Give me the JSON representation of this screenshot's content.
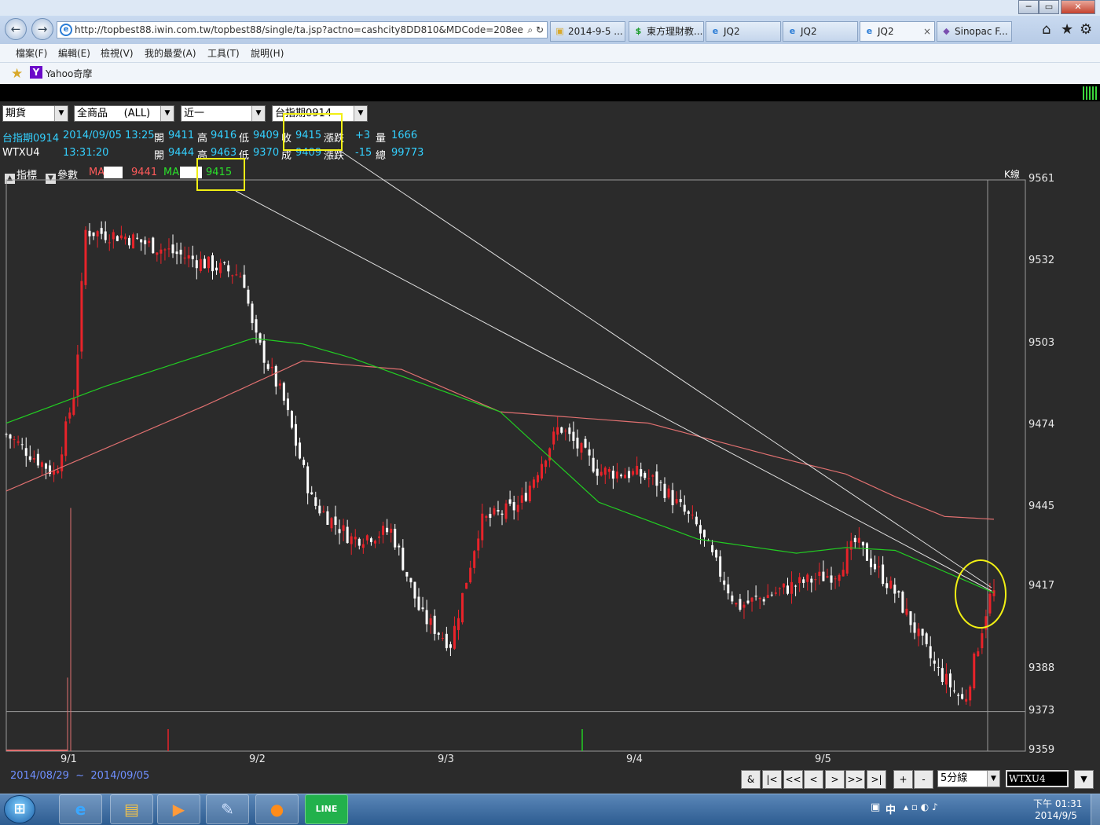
{
  "browser": {
    "nav_back": "←",
    "nav_forward": "→",
    "url": "http://topbest88.iwin.com.tw/topbest88/single/ta.jsp?actno=cashcity8DD810&MDCode=208ee",
    "url_icons": "⌕ ↻",
    "tabs": [
      {
        "label": "2014-9-5 ...",
        "icon": "folder-icon"
      },
      {
        "label": "東方理財教...",
        "icon": "dollar-icon"
      },
      {
        "label": "JQ2",
        "icon": "ie-icon"
      },
      {
        "label": "JQ2",
        "icon": "ie-icon"
      },
      {
        "label": "JQ2",
        "icon": "ie-icon",
        "close": "×"
      },
      {
        "label": "Sinopac F...",
        "icon": "sinopac-icon"
      }
    ],
    "tool_icons": {
      "home": "⌂",
      "favorites": "★",
      "settings": "⚙"
    },
    "window_buttons": {
      "min": "─",
      "max": "▭",
      "close": "✕"
    },
    "menu": [
      "檔案(F)",
      "編輯(E)",
      "檢視(V)",
      "我的最愛(A)",
      "工具(T)",
      "說明(H)"
    ],
    "favorites": {
      "yahoo_icon": "Y",
      "yahoo_label": "Yahoo奇摩"
    }
  },
  "app": {
    "selects": {
      "market": "期貨",
      "product": "全商品     (ALL)",
      "contract_month": "近一",
      "symbol": "台指期0914"
    },
    "quote1": {
      "name": "台指期0914",
      "datetime": "2014/09/05 13:25",
      "open_label": "開",
      "open": "9411",
      "high_label": "高",
      "high": "9416",
      "low_label": "低",
      "low": "9409",
      "close_label": "收",
      "close": "9415",
      "change_label": "漲跌",
      "change": "+3",
      "volume_label": "量",
      "volume": "1666"
    },
    "quote2": {
      "name": "WTXU4",
      "time": "13:31:20",
      "open_label": "開",
      "open": "9444",
      "high_label": "高",
      "high": "9463",
      "low_label": "低",
      "low": "9370",
      "last_label": "成",
      "last": "9409",
      "change_label": "漲跌",
      "change": "-15",
      "total_label": "總",
      "total": "99773"
    },
    "indicator_bar": {
      "indicator_label": "指標",
      "param_label": "參數",
      "ma1_label": "MA",
      "ma1_value": "9441",
      "ma2_label": "MA",
      "ma2_value": "9415",
      "arrow_up": "▲",
      "arrow_down": "▼"
    },
    "chart_label": "K線",
    "range": {
      "start": "2014/08/29",
      "sep": "~",
      "end": "2014/09/05"
    },
    "controls": [
      "&",
      "|<",
      "<<",
      "<",
      ">",
      ">>",
      ">|",
      "+",
      "-"
    ],
    "period": "5分線",
    "code": "WTXU4",
    "code_btn": "▼",
    "dropdown_arrow": "▼",
    "colors": {
      "up": "#e8232a",
      "down": "#ffffff",
      "ma_long": "#e07070",
      "ma_short": "#22cc22",
      "annotation": "#f1ef14"
    }
  },
  "chart_data": {
    "type": "candlestick",
    "ylim": [
      9359,
      9561
    ],
    "yticks": [
      "9561",
      "9532",
      "9503",
      "9474",
      "9445",
      "9417",
      "9388",
      "9373",
      "9359"
    ],
    "xticks": [
      "9/1",
      "9/2",
      "9/3",
      "9/4",
      "9/5"
    ],
    "series": [
      {
        "name": "MA",
        "color": "#e07070",
        "x": [
          0.0,
          0.2,
          0.3,
          0.4,
          0.5,
          0.65,
          0.78,
          0.85,
          0.9,
          0.95,
          1.0
        ],
        "values": [
          9451,
          9481,
          9497,
          9494,
          9479,
          9475,
          9463,
          9457,
          9449,
          9442,
          9441
        ]
      },
      {
        "name": "MA",
        "color": "#22cc22",
        "x": [
          0.0,
          0.1,
          0.25,
          0.3,
          0.35,
          0.5,
          0.6,
          0.7,
          0.8,
          0.85,
          0.9,
          1.0
        ],
        "values": [
          9475,
          9488,
          9505,
          9503,
          9498,
          9479,
          9447,
          9434,
          9429,
          9431,
          9430,
          9415
        ]
      },
      {
        "name": "close",
        "color": "#ffffff",
        "x": [
          0.0,
          0.05,
          0.07,
          0.08,
          0.12,
          0.24,
          0.25,
          0.28,
          0.31,
          0.35,
          0.39,
          0.42,
          0.45,
          0.48,
          0.52,
          0.56,
          0.6,
          0.64,
          0.66,
          0.7,
          0.74,
          0.8,
          0.84,
          0.86,
          0.9,
          0.94,
          0.97,
          0.995,
          1.0
        ],
        "values": [
          9471,
          9457,
          9488,
          9543,
          9541,
          9527,
          9507,
          9484,
          9447,
          9434,
          9437,
          9407,
          9397,
          9440,
          9446,
          9474,
          9458,
          9457,
          9454,
          9438,
          9410,
          9418,
          9422,
          9433,
          9415,
          9389,
          9376,
          9413,
          9415
        ]
      }
    ],
    "annotations": {
      "highlight_close": "9415",
      "highlight_ma": "9415"
    }
  },
  "taskbar": {
    "start": "⊞",
    "apps": [
      {
        "name": "ie",
        "glyph": "e"
      },
      {
        "name": "explorer",
        "glyph": "▤"
      },
      {
        "name": "media-player",
        "glyph": "▶"
      },
      {
        "name": "painter",
        "glyph": "✎"
      },
      {
        "name": "orange-app",
        "glyph": "●"
      },
      {
        "name": "line",
        "glyph": "LINE"
      }
    ],
    "tray": {
      "lang": "中",
      "time": "下午 01:31",
      "date": "2014/9/5",
      "icons": "▴ ▫ ◐ ♪"
    }
  }
}
